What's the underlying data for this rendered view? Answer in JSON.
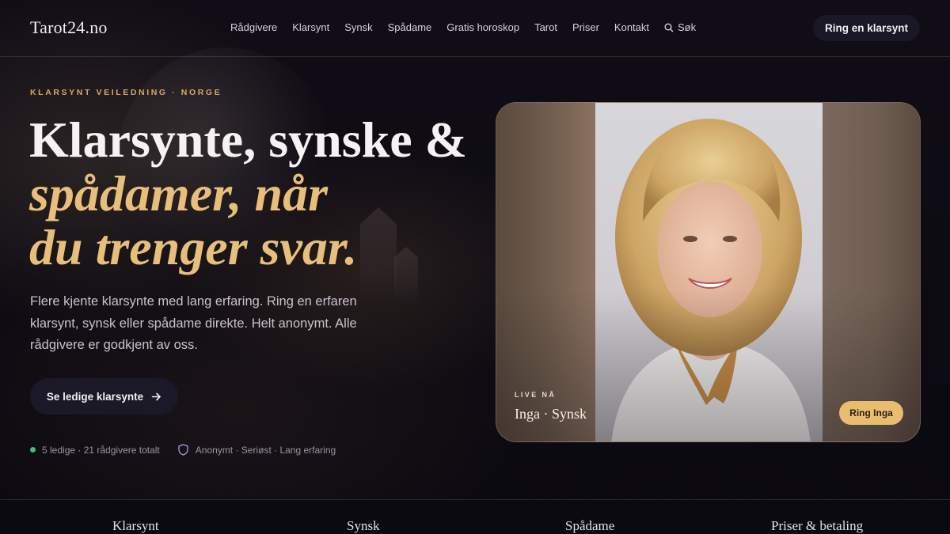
{
  "header": {
    "logo": "Tarot24.no",
    "menu": [
      "Rådgivere",
      "Klarsynt",
      "Synsk",
      "Spådame",
      "Gratis horoskop",
      "Tarot",
      "Priser",
      "Kontakt"
    ],
    "search_label": "Søk",
    "cta_label": "Ring en klarsynt"
  },
  "hero": {
    "eyebrow": "KLARSYNT VEILEDNING · NORGE",
    "title_line1": "Klarsynte, synske &",
    "title_line2": "spådamer, når",
    "title_line3": "du trenger svar.",
    "lead": "Flere kjente klarsynte med lang erfaring. Ring en erfaren klarsynt, synsk eller spådame direkte. Helt anonymt. Alle rådgivere er godkjent av oss.",
    "button_label": "Se ledige klarsynte",
    "status_text": "5 ledige · 21 rådgivere totalt",
    "trust_text": "Anonymt · Seriøst · Lang erfaring"
  },
  "featured": {
    "live_label": "LIVE NÅ",
    "name": "Inga · Synsk",
    "call_label": "Ring Inga"
  },
  "categories": [
    "Klarsynt",
    "Synsk",
    "Spådame",
    "Priser & betaling"
  ],
  "colors": {
    "accent_gold": "#e8bf7a",
    "eyebrow_orange": "#d9a56a",
    "status_green": "#3fc07a",
    "background": "#0c0a12"
  }
}
